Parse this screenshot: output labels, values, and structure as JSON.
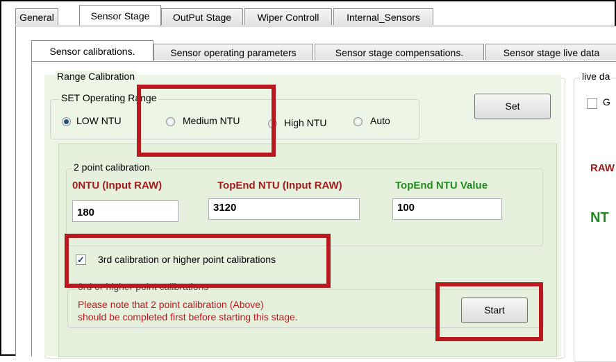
{
  "main_tabs": [
    {
      "label": "General"
    },
    {
      "label": "Sensor Stage"
    },
    {
      "label": "OutPut Stage"
    },
    {
      "label": "Wiper Controll"
    },
    {
      "label": "Internal_Sensors"
    }
  ],
  "sub_tabs": [
    {
      "label": "Sensor calibrations."
    },
    {
      "label": "Sensor operating parameters"
    },
    {
      "label": "Sensor stage compensations."
    },
    {
      "label": "Sensor stage live data"
    }
  ],
  "range_calibration": {
    "group_label": "Range Calibration",
    "set_range_label": "SET Operating Range",
    "radios": [
      {
        "label": "LOW NTU",
        "checked": true
      },
      {
        "label": "Medium NTU",
        "checked": false
      },
      {
        "label": "High NTU",
        "checked": false
      },
      {
        "label": "Auto",
        "checked": false
      }
    ],
    "set_button": "Set"
  },
  "two_point": {
    "group_label": "2 point calibration.",
    "col1_label": "0NTU (Input RAW)",
    "col2_label": "TopEnd NTU (Input RAW)",
    "col3_label": "TopEnd NTU Value",
    "col1_value": "180",
    "col2_value": "3120",
    "col3_value": "100"
  },
  "third_point": {
    "checkbox_label": "3rd calibration or higher point calibrations",
    "checked": true,
    "group_label": "3rd or higher point calibrations",
    "note_line1": "Please note that 2 point calibration (Above)",
    "note_line2": "should be completed first before starting this stage.",
    "start_button": "Start"
  },
  "live_data": {
    "group_label": "live da",
    "checkbox_label": "G",
    "raw_label": "RAW",
    "ntu_label": "NT"
  },
  "colors": {
    "highlight_red": "#b7191f",
    "label_red": "#a01c1c",
    "label_green": "#1f8a1f",
    "note_red": "#c0141c"
  }
}
